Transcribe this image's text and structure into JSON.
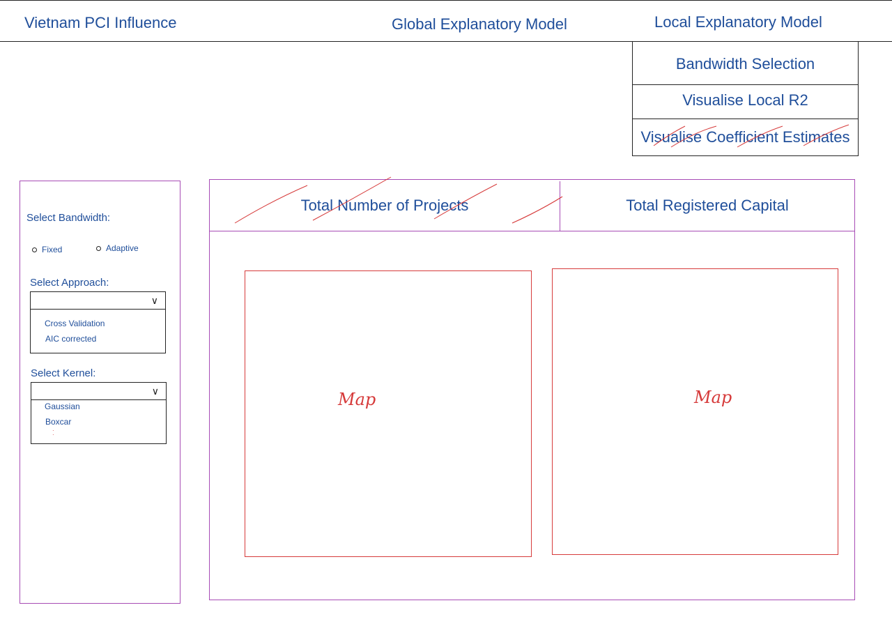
{
  "header": {
    "app_title": "Vietnam PCI Influence",
    "nav_global": "Global Explanatory Model",
    "nav_local": "Local Explanatory Model"
  },
  "local_menu": {
    "items": [
      "Bandwidth Selection",
      "Visualise Local R2",
      "Visualise Coefficient Estimates"
    ]
  },
  "sidebar": {
    "bandwidth_label": "Select Bandwidth:",
    "bandwidth_options": [
      "Fixed",
      "Adaptive"
    ],
    "approach_label": "Select Approach:",
    "approach_options": [
      "Cross Validation",
      "AIC corrected"
    ],
    "kernel_label": "Select Kernel:",
    "kernel_options": [
      "Gaussian",
      "Boxcar"
    ]
  },
  "main": {
    "tabs": [
      "Total Number of Projects",
      "Total Registered Capital"
    ],
    "maps": [
      "Map",
      "Map"
    ]
  },
  "colors": {
    "text": "#1f4e9a",
    "panel_border": "#a74bb5",
    "map_border": "#d63a3a"
  }
}
